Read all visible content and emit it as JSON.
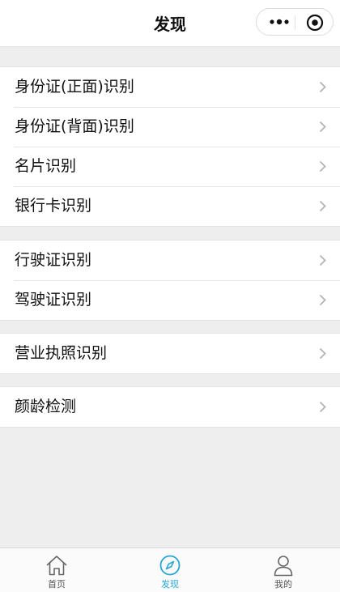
{
  "header": {
    "title": "发现"
  },
  "groups": [
    {
      "items": [
        {
          "label": "身份证(正面)识别"
        },
        {
          "label": "身份证(背面)识别"
        },
        {
          "label": "名片识别"
        },
        {
          "label": "银行卡识别"
        }
      ]
    },
    {
      "items": [
        {
          "label": "行驶证识别"
        },
        {
          "label": "驾驶证识别"
        }
      ]
    },
    {
      "items": [
        {
          "label": "营业执照识别"
        }
      ]
    },
    {
      "items": [
        {
          "label": "颜龄检测"
        }
      ]
    }
  ],
  "tabbar": {
    "items": [
      {
        "label": "首页",
        "icon": "home-icon",
        "active": false
      },
      {
        "label": "发现",
        "icon": "compass-icon",
        "active": true
      },
      {
        "label": "我的",
        "icon": "user-icon",
        "active": false
      }
    ]
  },
  "colors": {
    "accent": "#2aa6d3",
    "background": "#eeeeee"
  }
}
